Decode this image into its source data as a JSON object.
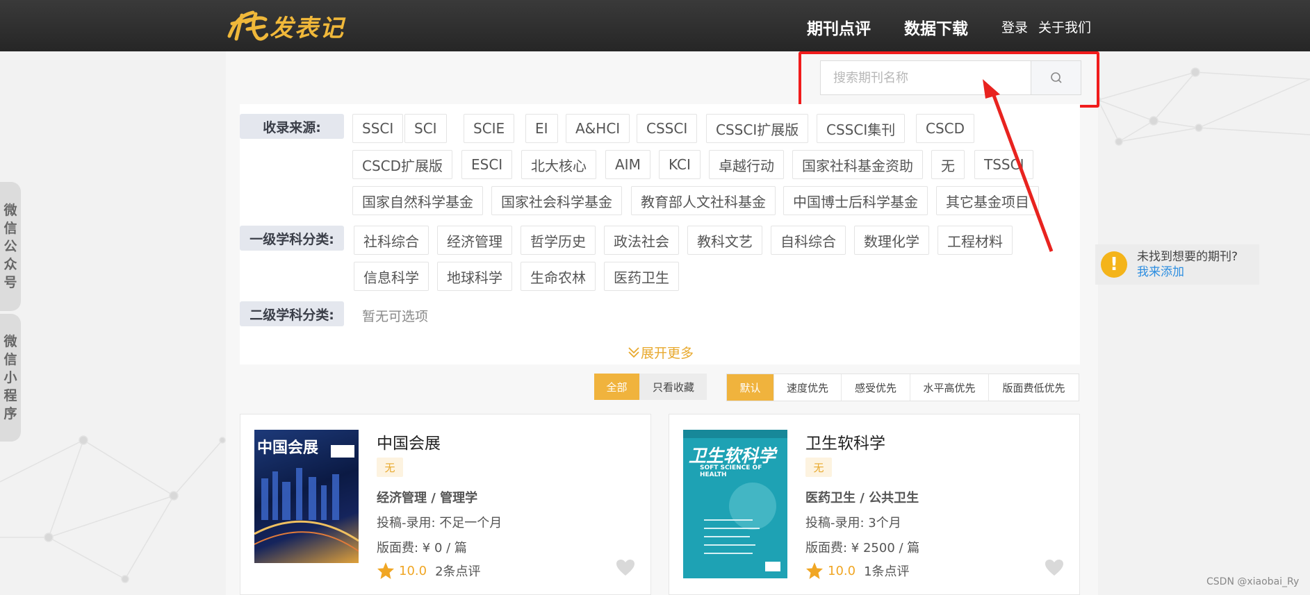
{
  "colors": {
    "accent": "#f0b33d",
    "highlight_box": "#f01c1c",
    "link": "#2d8ee0"
  },
  "header": {
    "logo_text": "发表记",
    "nav_review": "期刊点评",
    "nav_download": "数据下载",
    "nav_login": "登录",
    "nav_about": "关于我们"
  },
  "search": {
    "placeholder": "搜索期刊名称",
    "icon": "search-icon"
  },
  "filters": {
    "source_label": "收录来源:",
    "source_tags": [
      "SSCI",
      "SCI",
      "SCIE",
      "EI",
      "A&HCI",
      "CSSCI",
      "CSSCI扩展版",
      "CSSCI集刊",
      "CSCD",
      "CSCD扩展版",
      "ESCI",
      "北大核心",
      "AIM",
      "KCI",
      "卓越行动",
      "国家社科基金资助",
      "无",
      "TSSCI",
      "国家自然科学基金",
      "国家社会科学基金",
      "教育部人文社科基金",
      "中国博士后科学基金",
      "其它基金项目"
    ],
    "level1_label": "一级学科分类:",
    "level1_tags": [
      "社科综合",
      "经济管理",
      "哲学历史",
      "政法社会",
      "教科文艺",
      "自科综合",
      "数理化学",
      "工程材料",
      "信息科学",
      "地球科学",
      "生命农林",
      "医药卫生"
    ],
    "level2_label": "二级学科分类:",
    "level2_empty": "暂无可选项",
    "expand_more": "展开更多"
  },
  "view_toggle": [
    "全部",
    "只看收藏"
  ],
  "sort_options": [
    "默认",
    "速度优先",
    "感受优先",
    "水平高优先",
    "版面费低优先"
  ],
  "journals": [
    {
      "title": "中国会展",
      "badge": "无",
      "subject": "经济管理 / 管理学",
      "timeline": "投稿-录用:  不足一个月",
      "fee": "版面费:  ¥ 0 / 篇",
      "score": "10.0",
      "reviews": "2条点评",
      "cover_title": "中国会展"
    },
    {
      "title": "卫生软科学",
      "badge": "无",
      "subject": "医药卫生 / 公共卫生",
      "timeline": "投稿-录用:  3个月",
      "fee": "版面费:  ¥ 2500 / 篇",
      "score": "10.0",
      "reviews": "1条点评",
      "cover_title": "卫生软科学",
      "cover_subtitle": "SOFT SCIENCE OF HEALTH"
    }
  ],
  "side_tabs": [
    "微信公众号",
    "微信小程序"
  ],
  "not_found": {
    "question": "未找到想要的期刊?",
    "link": "我来添加"
  },
  "watermark": "CSDN @xiaobai_Ry"
}
